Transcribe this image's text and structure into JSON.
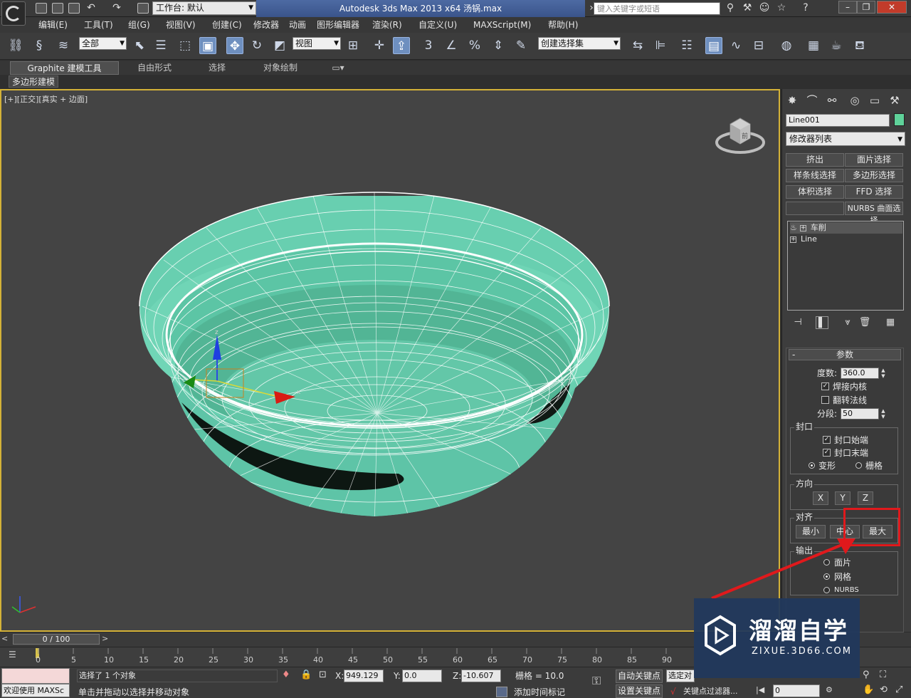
{
  "titlebar": {
    "workspace_label": "工作台: 默认",
    "title": "Autodesk 3ds Max  2013 x64      汤锅.max",
    "search_placeholder": "键入关键字或短语",
    "icons": [
      "binoculars-icon",
      "tools-icon",
      "users-icon",
      "star-icon",
      "help-icon"
    ],
    "window_controls": [
      "minimize",
      "restore",
      "close"
    ]
  },
  "menu": {
    "items": [
      "编辑(E)",
      "工具(T)",
      "组(G)",
      "视图(V)",
      "创建(C)",
      "修改器",
      "动画",
      "图形编辑器",
      "渲染(R)",
      "自定义(U)",
      "MAXScript(M)",
      "帮助(H)"
    ]
  },
  "toolbar": {
    "filter_value": "全部",
    "ref_coord_value": "视图",
    "selection_set_value": "创建选择集",
    "snap_label": "3"
  },
  "ribbon": {
    "tabs": [
      "Graphite 建模工具",
      "自由形式",
      "选择",
      "对象绘制"
    ],
    "active_tab": "Graphite 建模工具",
    "sub_label": "多边形建模"
  },
  "viewport": {
    "label": "[+][正交][真实 + 边面]",
    "viewcube_face": "前",
    "gizmo_z": "z",
    "gizmo_x": "x"
  },
  "command_panel": {
    "object_name": "Line001",
    "object_color": "#5fd29a",
    "modifier_list": "修改器列表",
    "modifier_buttons": [
      "挤出",
      "面片选择",
      "样条线选择",
      "多边形选择",
      "体积选择",
      "FFD 选择",
      "",
      "NURBS 曲面选择"
    ],
    "stack": [
      {
        "name": "车削",
        "selected": true
      },
      {
        "name": "Line",
        "selected": false
      }
    ],
    "params": {
      "header": "参数",
      "degrees_label": "度数:",
      "degrees_value": "360.0",
      "weld_core_label": "焊接内核",
      "weld_core_checked": true,
      "flip_normals_label": "翻转法线",
      "flip_normals_checked": false,
      "segments_label": "分段:",
      "segments_value": "50",
      "capping": {
        "title": "封口",
        "cap_start": "封口始端",
        "cap_end": "封口末端",
        "morph": "变形",
        "grid": "栅格",
        "selected": "变形"
      },
      "direction": {
        "title": "方向",
        "x": "X",
        "y": "Y",
        "z": "Z"
      },
      "align": {
        "title": "对齐",
        "min": "最小",
        "center": "中心",
        "max": "最大"
      },
      "output": {
        "title": "输出",
        "patch": "面片",
        "mesh": "网格",
        "nurbs": "NURBS",
        "selected": "网格"
      }
    }
  },
  "timeline": {
    "slider_label": "0 / 100",
    "ticks": [
      "0",
      "5",
      "10",
      "15",
      "20",
      "25",
      "30",
      "35",
      "40",
      "45",
      "50",
      "55",
      "60",
      "65",
      "70",
      "75",
      "80",
      "85",
      "90"
    ]
  },
  "status": {
    "welcome": "欢迎使用 MAXSc",
    "selected_msg": "选择了 1 个对象",
    "prompt_msg": "单击并拖动以选择并移动对象",
    "x_label": "X:",
    "x_value": "949.129",
    "y_label": "Y:",
    "y_value": "0.0",
    "z_label": "Z:",
    "z_value": "-10.607",
    "grid_label": "栅格 = 10.0",
    "add_time_tag": "添加时间标记",
    "auto_key": "自动关键点",
    "set_key": "设置关键点",
    "selected_dropdown": "选定对",
    "key_filters": "关键点过滤器...",
    "frame_value": "0"
  },
  "watermark": {
    "title": "溜溜自学",
    "subtitle": "ZIXUE.3D66.COM"
  }
}
